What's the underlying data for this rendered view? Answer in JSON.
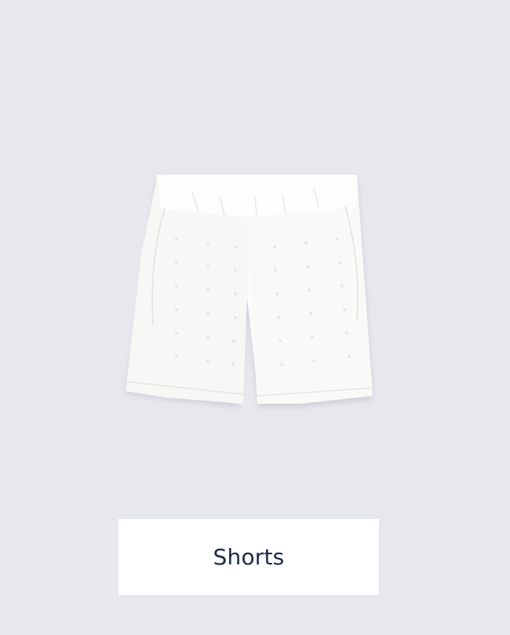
{
  "category_card": {
    "label": "Shorts",
    "image_subject": "white-eyelet-shorts",
    "background_color": "#e7e8ed",
    "label_color": "#1c2a44"
  }
}
